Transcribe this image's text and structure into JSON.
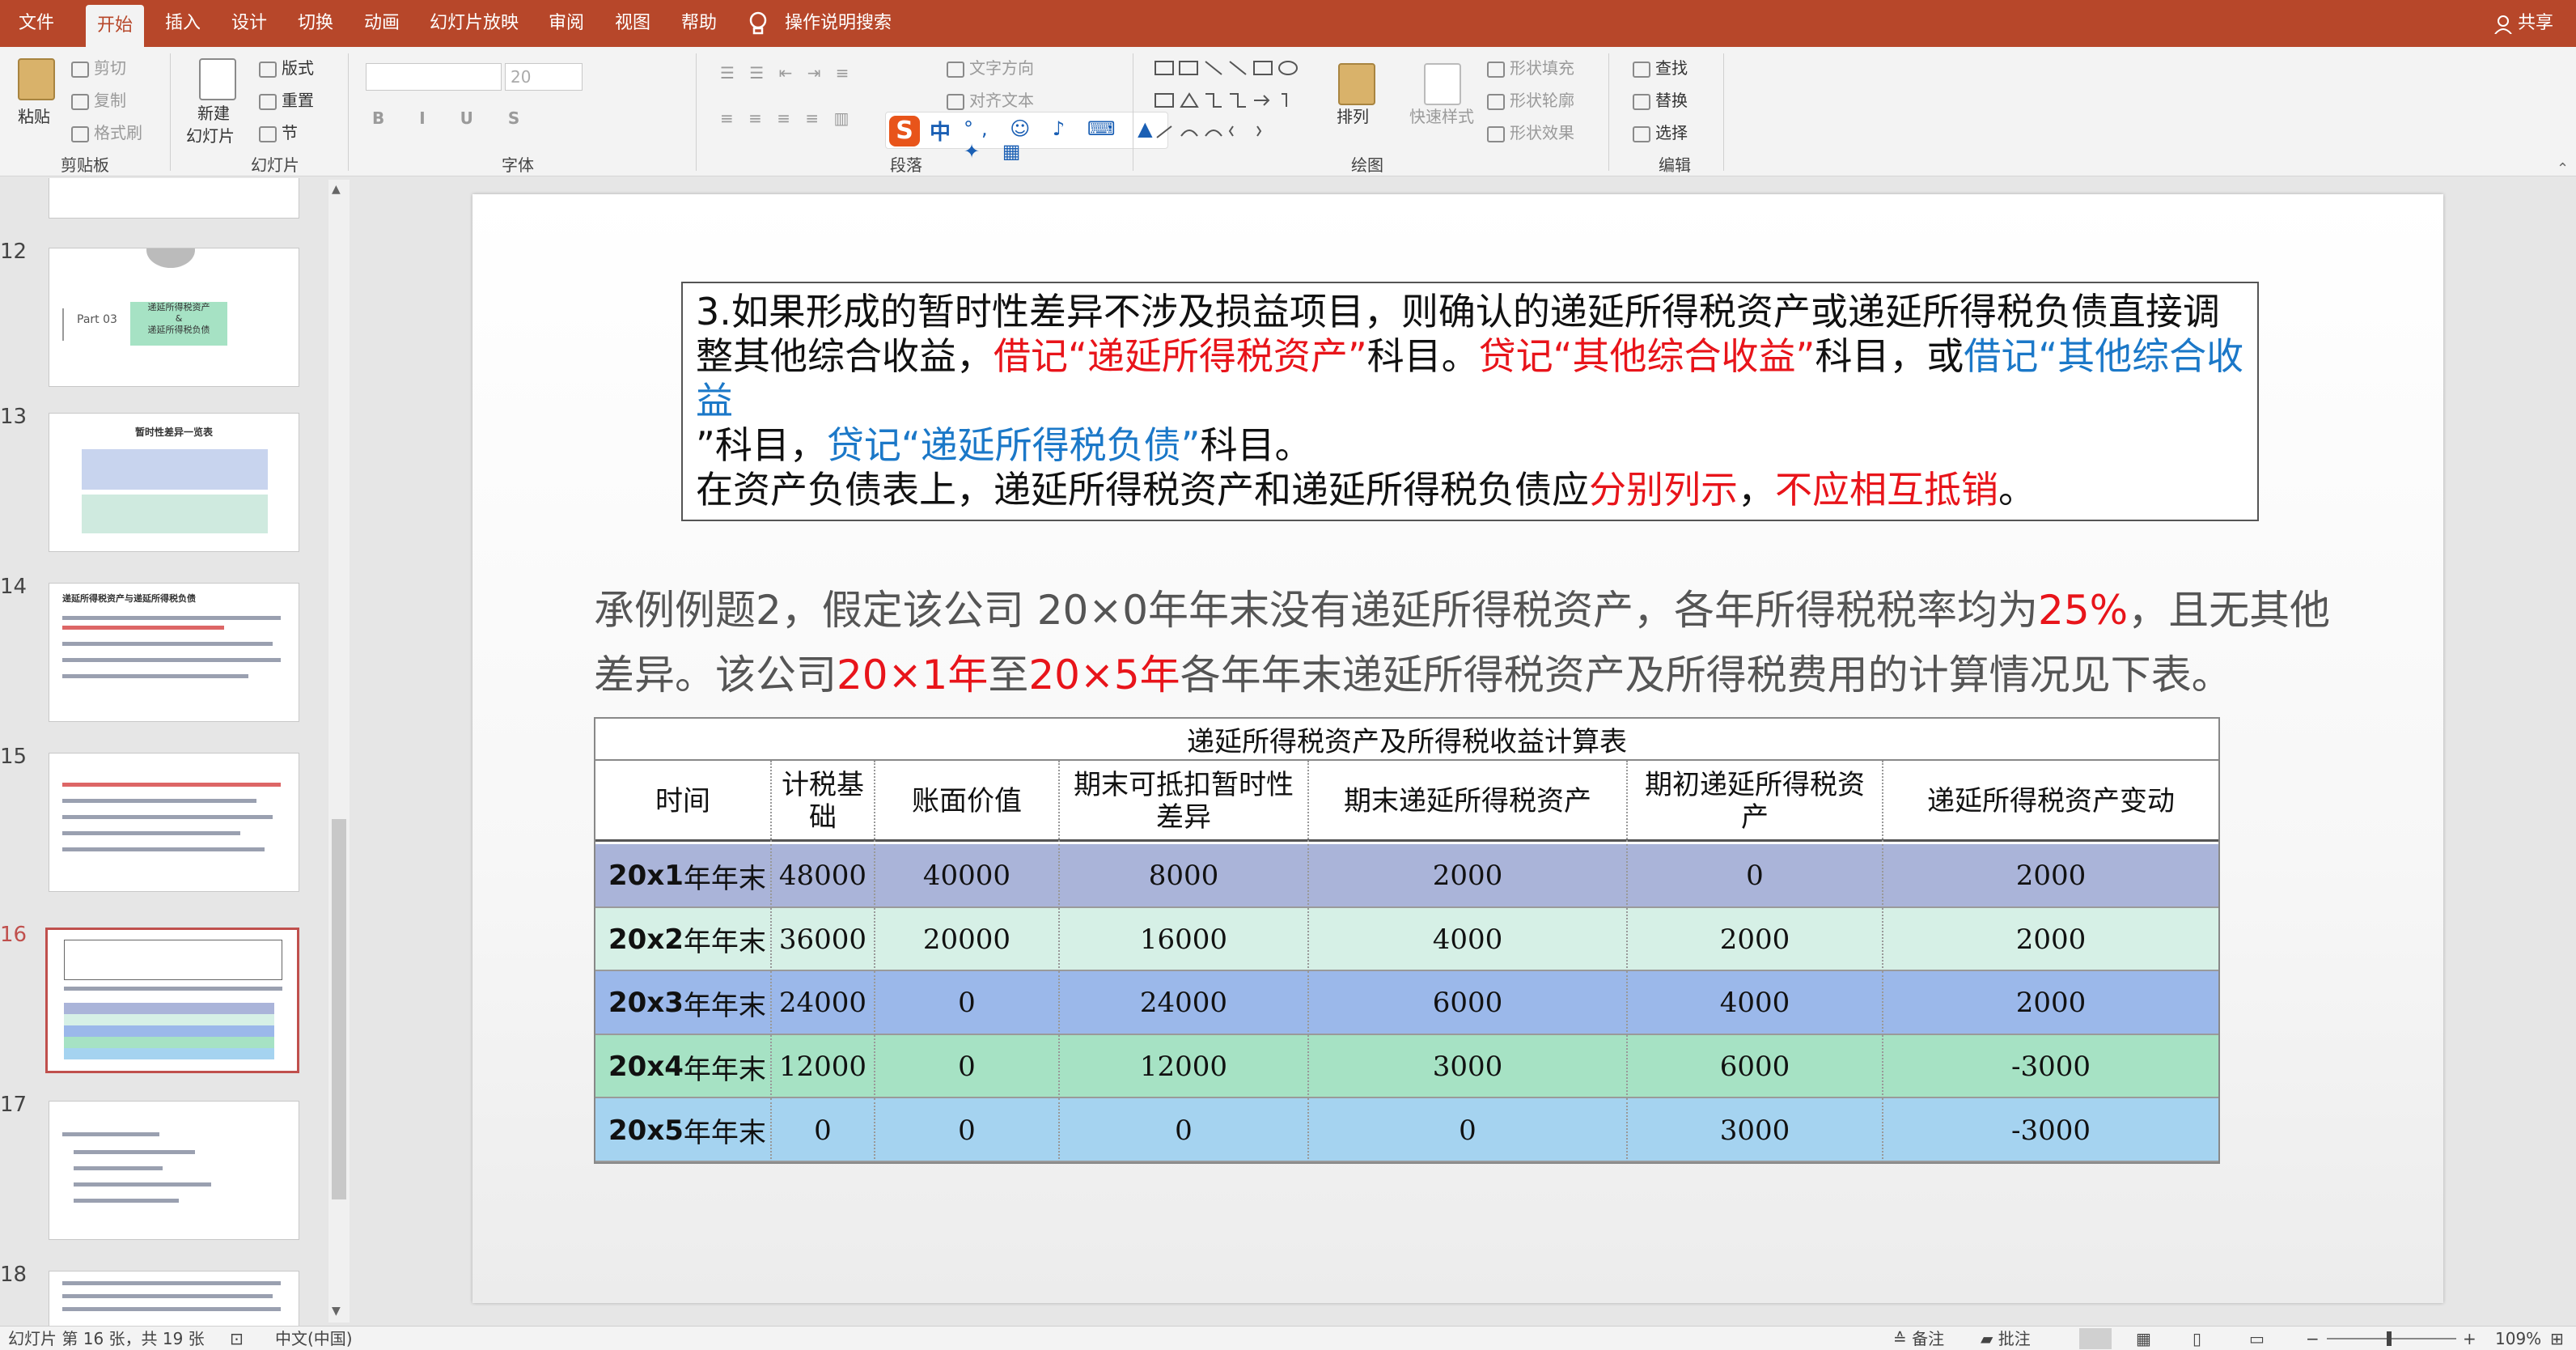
{
  "tabs": [
    "文件",
    "开始",
    "插入",
    "设计",
    "切换",
    "动画",
    "幻灯片放映",
    "审阅",
    "视图",
    "帮助"
  ],
  "search_label": "操作说明搜索",
  "share_label": "共享",
  "ribbon": {
    "clipboard": {
      "paste": "粘贴",
      "cut": "剪切",
      "copy": "复制",
      "format_painter": "格式刷",
      "label": "剪贴板"
    },
    "slides": {
      "new_slide_1": "新建",
      "new_slide_2": "幻灯片",
      "layout": "版式",
      "reset": "重置",
      "section": "节",
      "label": "幻灯片"
    },
    "font": {
      "size": "20",
      "label": "字体"
    },
    "paragraph": {
      "text_direction": "文字方向",
      "align_text": "对齐文本",
      "label": "段落"
    },
    "drawing": {
      "arrange": "排列",
      "quick_styles": "快速样式",
      "shape_fill": "形状填充",
      "shape_outline": "形状轮廓",
      "shape_effects": "形状效果",
      "label": "绘图"
    },
    "editing": {
      "find": "查找",
      "replace": "替换",
      "select": "选择",
      "label": "编辑"
    },
    "ime": {
      "lang": "中"
    }
  },
  "thumbnails": [
    {
      "num": "12",
      "part": "Part 03",
      "box1": "递延所得税资产",
      "box2": "&",
      "box3": "递延所得税负债"
    },
    {
      "num": "13",
      "title": "暂时性差异一览表"
    },
    {
      "num": "14",
      "title": "递延所得税资产与递延所得税负债"
    },
    {
      "num": "15"
    },
    {
      "num": "16"
    },
    {
      "num": "17"
    },
    {
      "num": "18"
    }
  ],
  "slide": {
    "box": {
      "l1": "3.如果形成的暂时性差异不涉及损益项目，则确认的递延所得税资产或递延所得税负债直接调",
      "l2a": "整其他综合收益，",
      "l2b": "借记“递延所得税资产”",
      "l2c": "科目。",
      "l2d": "贷记“其他综合收益”",
      "l2e": "科目，或",
      "l2f": "借记“其他综合收益",
      "l3a": "”科目，",
      "l3b": "贷记“递延所得税负债”",
      "l3c": "科目。",
      "l4a": "在资产负债表上，递延所得税资产和递延所得税负债应",
      "l4b": "分别列示",
      "l4c": "，",
      "l4d": "不应相互抵销",
      "l4e": "。"
    },
    "para": {
      "a": "承例例题2，假定该公司 20×0年年末没有递延所得税资产，各年所得税税率均为",
      "b": "25%",
      "c": "，且无其他",
      "d": "差异。该公司",
      "e": "20×1年",
      "f": "至",
      "g": "20×5年",
      "h": "各年年末递延所得税资产及所得税费用的计算情况见下表。"
    },
    "table": {
      "title": "递延所得税资产及所得税收益计算表",
      "headers": [
        "时间",
        "计税基础",
        "账面价值",
        "期末可抵扣暂时性差异",
        "期末递延所得税资产",
        "期初递延所得税资产",
        "递延所得税资产变动"
      ],
      "rows": [
        {
          "year": "20x1",
          "suffix": "年年末",
          "cells": [
            "48000",
            "40000",
            "8000",
            "2000",
            "0",
            "2000"
          ],
          "color": "#aab4d9"
        },
        {
          "year": "20x2",
          "suffix": "年年末",
          "cells": [
            "36000",
            "20000",
            "16000",
            "4000",
            "2000",
            "2000"
          ],
          "color": "#d6f0e6"
        },
        {
          "year": "20x3",
          "suffix": "年年末",
          "cells": [
            "24000",
            "0",
            "24000",
            "6000",
            "4000",
            "2000"
          ],
          "color": "#9bb8ea"
        },
        {
          "year": "20x4",
          "suffix": "年年末",
          "cells": [
            "12000",
            "0",
            "12000",
            "3000",
            "6000",
            "-3000"
          ],
          "color": "#a6e2c4"
        },
        {
          "year": "20x5",
          "suffix": "年年末",
          "cells": [
            "0",
            "0",
            "0",
            "0",
            "3000",
            "-3000"
          ],
          "color": "#a5d3f0"
        }
      ]
    }
  },
  "status": {
    "slide_info": "幻灯片 第 16 张，共 19 张",
    "language": "中文(中国)",
    "notes": "备注",
    "comments": "批注",
    "zoom": "109%"
  },
  "colors": {
    "accent": "#b7472a",
    "red_text": "#e8141a",
    "blue_text": "#1b78c8"
  }
}
